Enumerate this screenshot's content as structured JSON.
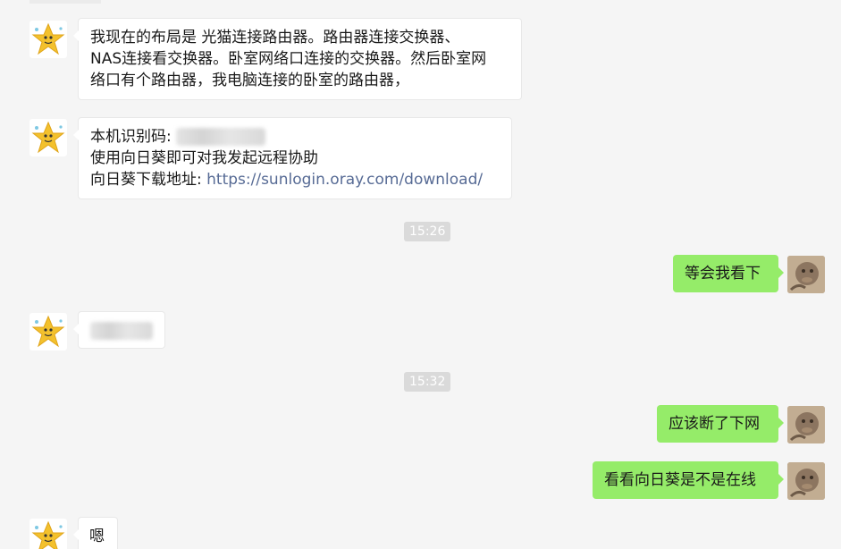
{
  "messages": [
    {
      "side": "left",
      "lines": [
        "我现在的布局是 光猫连接路由器。路由器连接交换器、",
        "NAS连接看交换器。卧室网络口连接的交换器。然后卧室网",
        "络口有个路由器，我电脑连接的卧室的路由器，"
      ]
    },
    {
      "side": "left",
      "id_label": "本机识别码:",
      "line2": "使用向日葵即可对我发起远程协助",
      "download_label": "向日葵下载地址: ",
      "download_url": "https://sunlogin.oray.com/download/"
    },
    {
      "side": "right",
      "text": "等会我看下"
    },
    {
      "side": "left",
      "redacted": true
    },
    {
      "side": "right",
      "text": "应该断了下网"
    },
    {
      "side": "right",
      "text": "看看向日葵是不是在线"
    },
    {
      "side": "left",
      "text": "嗯"
    }
  ],
  "timestamps": [
    "15:26",
    "15:32"
  ],
  "colors": {
    "background": "#f5f5f5",
    "self_bubble": "#95ec69",
    "other_bubble": "#ffffff",
    "link": "#576b95"
  },
  "icons": {
    "other_avatar": "star-cartoon-avatar-icon",
    "self_avatar": "photo-avatar-icon"
  }
}
